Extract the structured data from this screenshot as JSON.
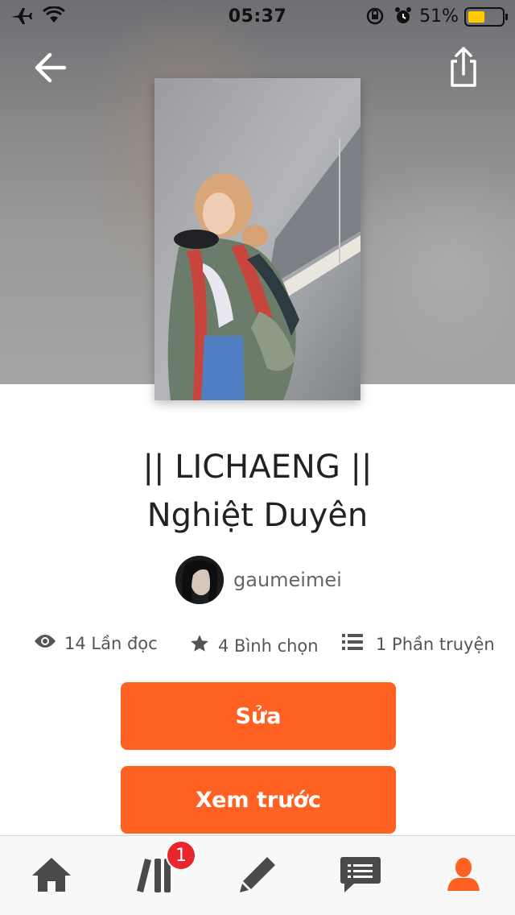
{
  "status_bar": {
    "time": "05:37",
    "battery_percent": "51%",
    "icons": [
      "airplane-icon",
      "wifi-icon",
      "rotation-lock-icon",
      "alarm-icon",
      "battery-icon"
    ],
    "battery_color": "#ffcc00"
  },
  "header": {
    "back_icon": "arrow-left-icon",
    "share_icon": "share-icon"
  },
  "story": {
    "title_line1": "|| LICHAENG ||",
    "title_line2": "Nghiệt Duyên",
    "author": "gaumeimei"
  },
  "stats": {
    "reads": "14 Lần đọc",
    "votes": "4 Bình chọn",
    "parts": "1 Phần truyện"
  },
  "actions": {
    "edit_label": "Sửa",
    "preview_label": "Xem trước"
  },
  "tab_bar": {
    "items": [
      "home-icon",
      "library-icon",
      "write-icon",
      "messages-icon",
      "profile-icon"
    ],
    "library_badge": "1",
    "active_color": "#ff6122",
    "inactive_color": "#4a4a4a"
  },
  "colors": {
    "accent": "#ff6122",
    "badge": "#e8262c"
  }
}
